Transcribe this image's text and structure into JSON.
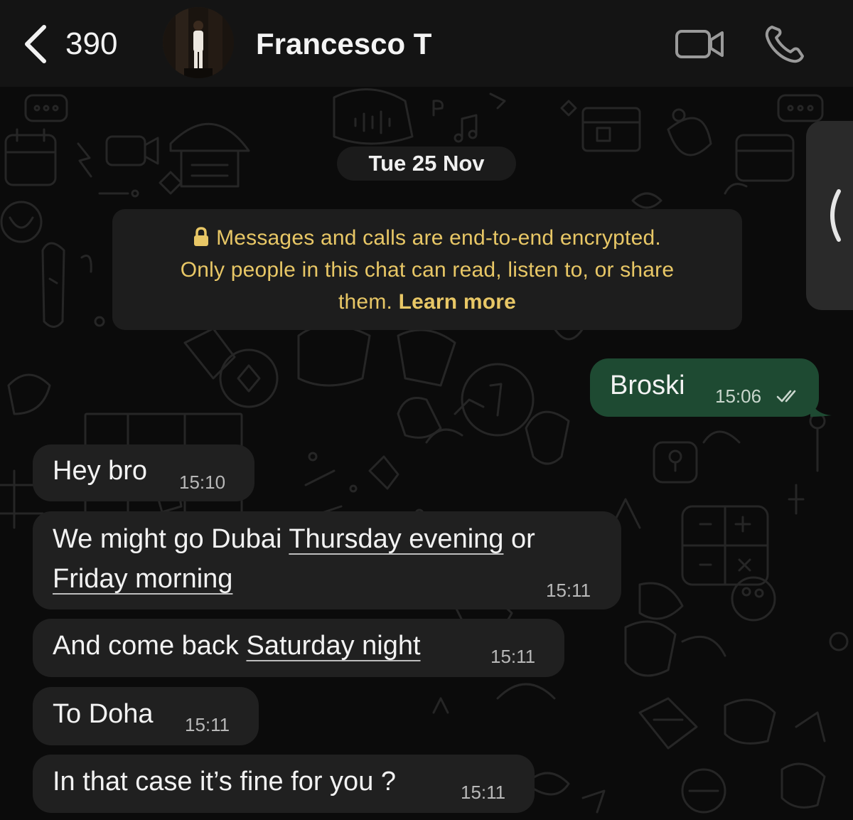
{
  "header": {
    "back_count": "390",
    "contact_name": "Francesco T"
  },
  "chat": {
    "date_label": "Tue 25 Nov",
    "encryption_notice": {
      "line1": "Messages and calls are end-to-end encrypted.",
      "line2": "Only people in this chat can read, listen to, or share",
      "line3": "them.",
      "learn_more": "Learn more"
    },
    "messages": [
      {
        "direction": "outgoing",
        "text": "Broski",
        "time": "15:06",
        "status": "read"
      },
      {
        "direction": "incoming",
        "text": "Hey bro",
        "time": "15:10"
      },
      {
        "direction": "incoming",
        "text_pre": "We might go Dubai ",
        "link1": "Thursday evening",
        "text_mid": " or",
        "link2": "Friday morning",
        "time": "15:11"
      },
      {
        "direction": "incoming",
        "text_pre": "And come back ",
        "link1": "Saturday night",
        "time": "15:11"
      },
      {
        "direction": "incoming",
        "text": "To Doha",
        "time": "15:11"
      },
      {
        "direction": "incoming",
        "text": "In that case it’s fine for you ?",
        "time": "15:11"
      }
    ]
  },
  "colors": {
    "header_bg": "#141414",
    "chat_bg": "#0b0b0b",
    "incoming_bubble": "#202020",
    "outgoing_bubble": "#1e4a32",
    "notice_text": "#e8c766"
  },
  "icons": [
    "chevron-left-icon",
    "video-camera-icon",
    "phone-icon",
    "lock-icon",
    "double-check-icon",
    "chevron-left-tab-icon"
  ]
}
